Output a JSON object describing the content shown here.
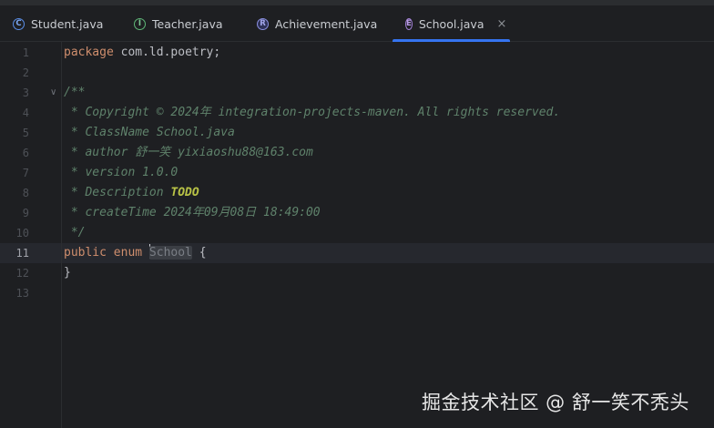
{
  "tabs": [
    {
      "label": "Student.java",
      "icon": "class-icon",
      "glyph": "C",
      "active": false
    },
    {
      "label": "Teacher.java",
      "icon": "interface-icon",
      "glyph": "I",
      "active": false
    },
    {
      "label": "Achievement.java",
      "icon": "record-icon",
      "glyph": "R",
      "active": false
    },
    {
      "label": "School.java",
      "icon": "enum-icon",
      "glyph": "E",
      "active": true
    }
  ],
  "close_glyph": "×",
  "fold_glyph": "∨",
  "line_numbers": [
    "1",
    "2",
    "3",
    "4",
    "5",
    "6",
    "7",
    "8",
    "9",
    "10",
    "11",
    "12",
    "13"
  ],
  "current_line": 11,
  "code": {
    "line1_kw": "package",
    "line1_rest": " com.ld.poetry;",
    "line3": "/**",
    "line4": " * Copyright © 2024年 integration-projects-maven. All rights reserved.",
    "line5": " * ClassName School.java",
    "line6": " * author 舒一笑 yixiaoshu88@163.com",
    "line7": " * version 1.0.0",
    "line8_pre": " * Description ",
    "line8_todo": "TODO",
    "line9": " * createTime 2024年09月08日 18:49:00",
    "line10": " */",
    "line11_kw": "public enum ",
    "line11_name": "School",
    "line11_rest": " {",
    "line12": "}"
  },
  "watermark": "掘金技术社区 @ 舒一笑不秃头",
  "colors": {
    "background": "#1e1f22",
    "keyword": "#cf8e6d",
    "doc_comment": "#5f826b",
    "todo": "#b8c246",
    "active_tab_underline": "#3574f0"
  }
}
